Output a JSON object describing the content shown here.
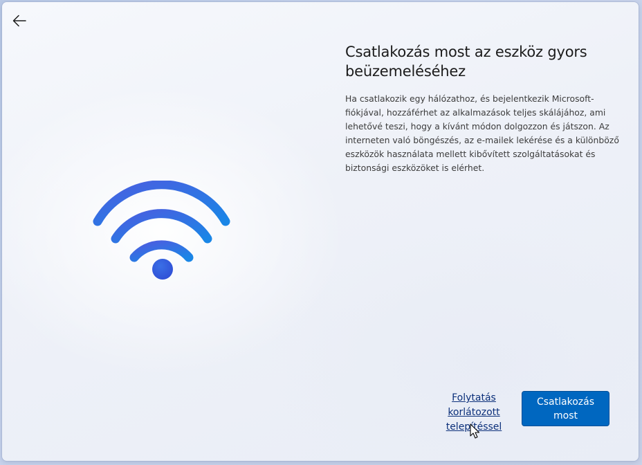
{
  "header": {
    "back_icon": "back-arrow-icon"
  },
  "illustration": {
    "icon": "wifi-icon",
    "colors": {
      "start": "#4a5ee0",
      "end": "#1a86e6"
    }
  },
  "main": {
    "title": "Csatlakozás most az eszköz gyors beüzemeléséhez",
    "description": "Ha csatlakozik egy hálózathoz, és bejelentkezik Microsoft-fiókjával, hozzáférhet az alkalmazások teljes skálájához, ami lehetővé teszi, hogy a kívánt módon dolgozzon és játszon. Az interneten való böngészés, az e-mailek lekérése és a különböző eszközök használata mellett kibővített szolgáltatásokat és biztonsági eszközöket is elérhet."
  },
  "actions": {
    "limited_setup_label": "Folytatás korlátozott telepítéssel",
    "connect_label": "Csatlakozás most",
    "accent_color": "#0067c0"
  }
}
